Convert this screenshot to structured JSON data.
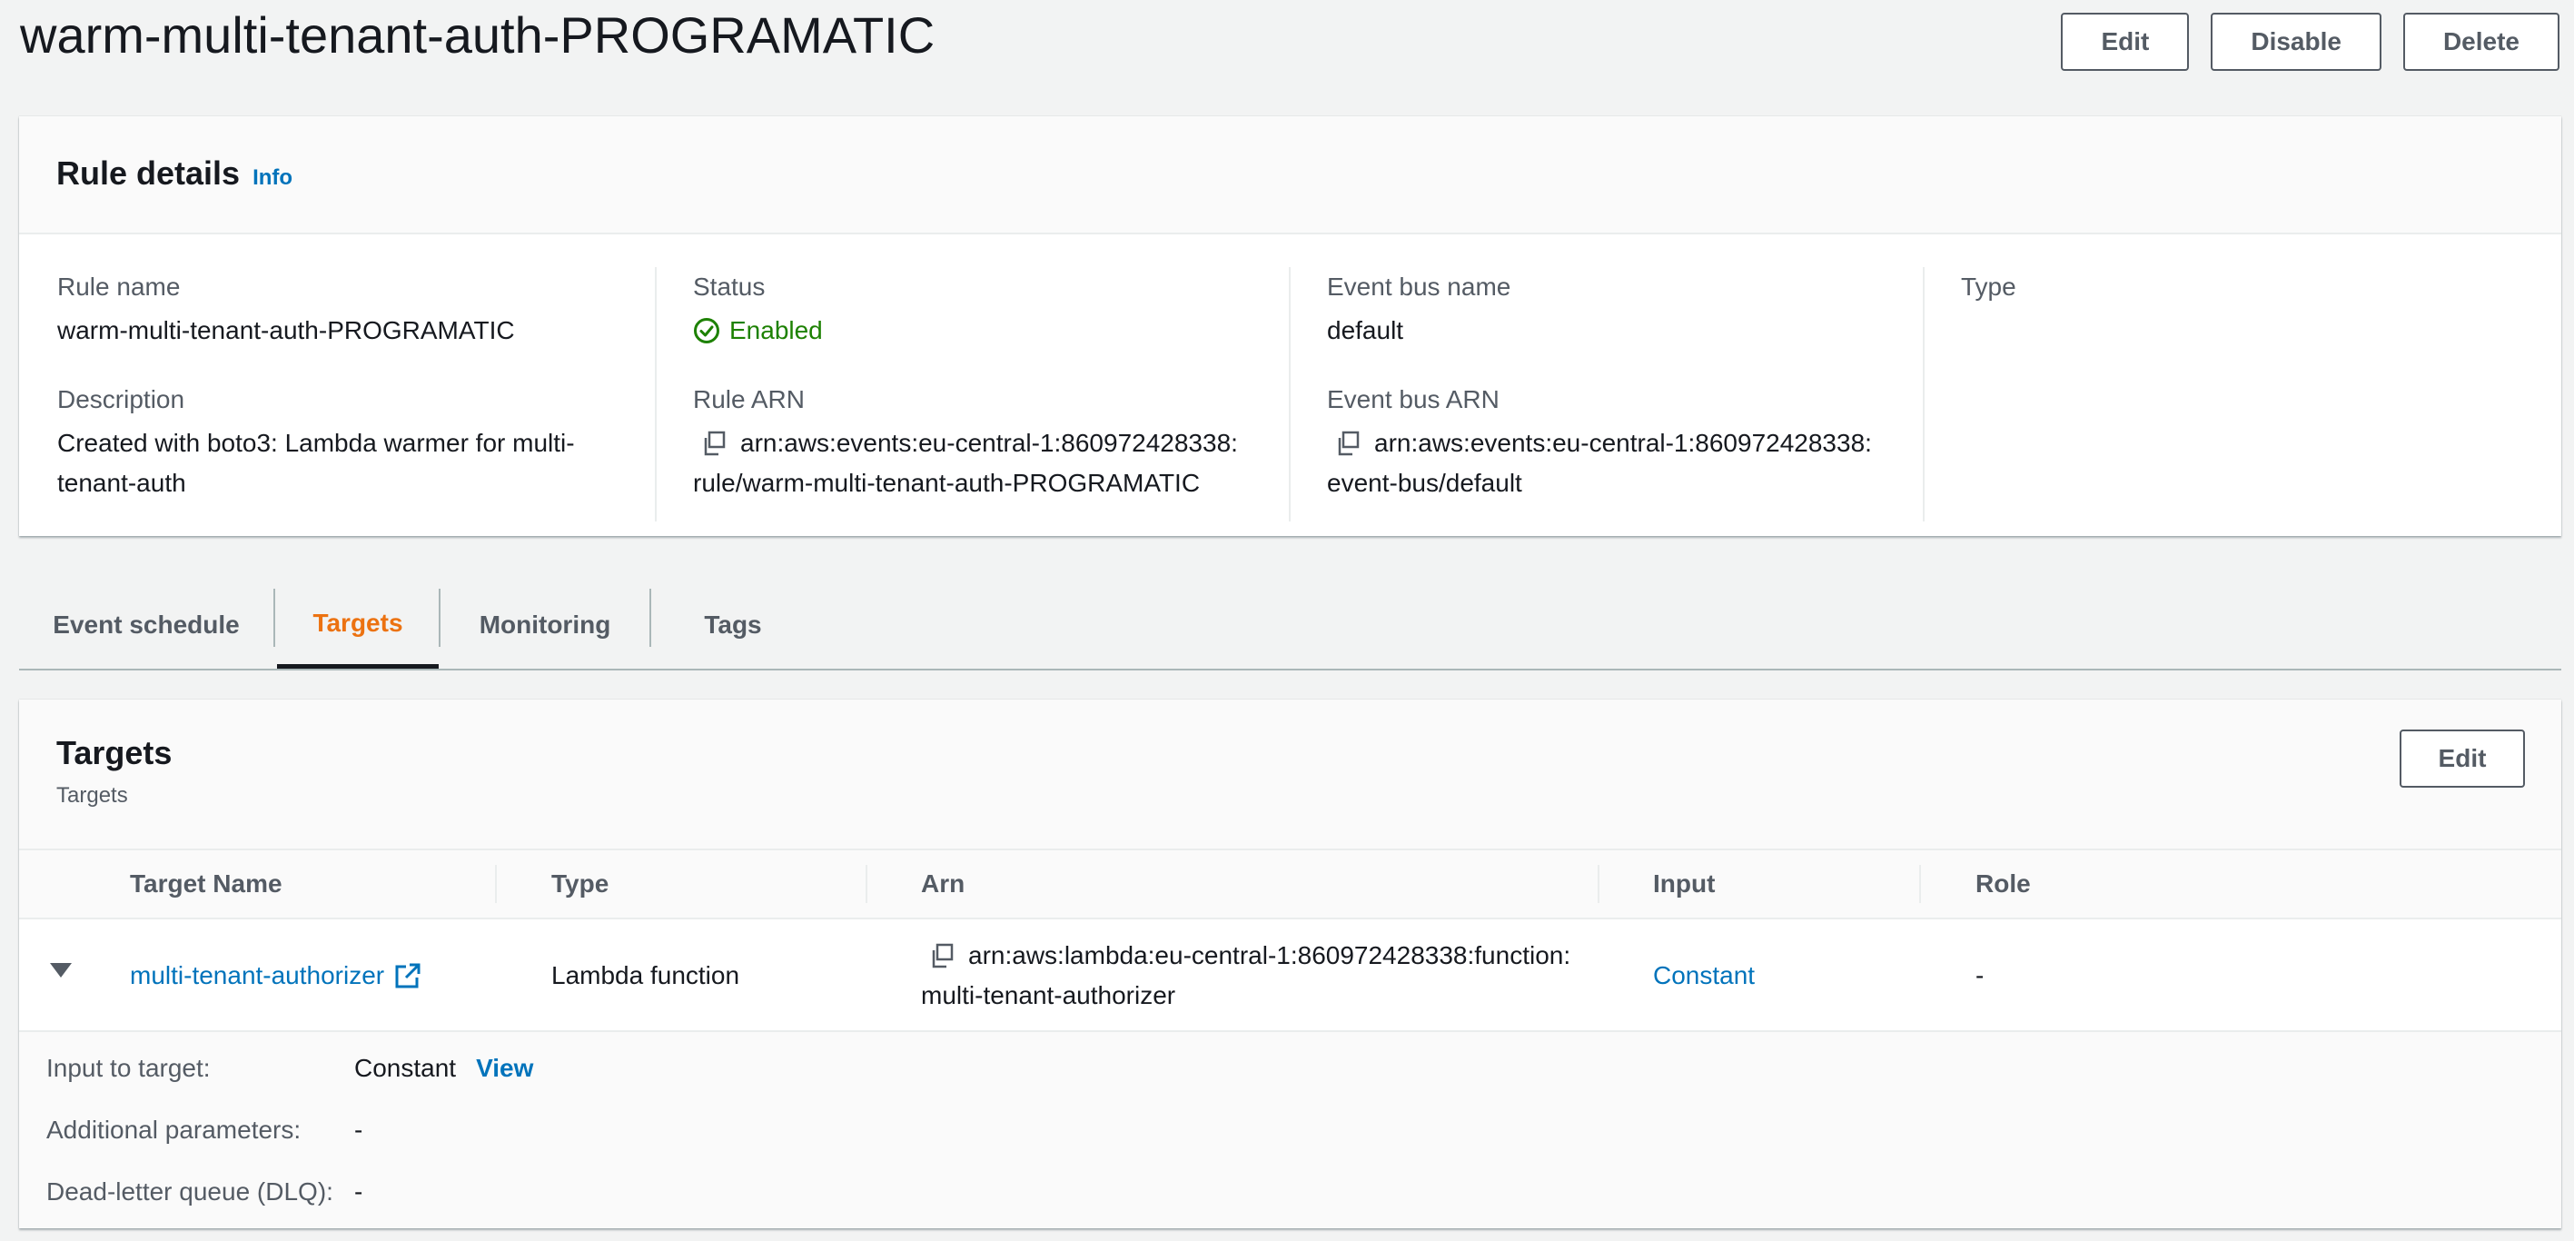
{
  "page": {
    "title": "warm-multi-tenant-auth-PROGRAMATIC"
  },
  "actions": {
    "edit": "Edit",
    "disable": "Disable",
    "delete": "Delete"
  },
  "rule_details": {
    "title": "Rule details",
    "info": "Info",
    "rule_name_label": "Rule name",
    "rule_name": "warm-multi-tenant-auth-PROGRAMATIC",
    "description_label": "Description",
    "description_line1": "Created with boto3: Lambda warmer for multi-",
    "description_line2": "tenant-auth",
    "status_label": "Status",
    "status": "Enabled",
    "rule_arn_label": "Rule ARN",
    "rule_arn_line1": "arn:aws:events:eu-central-1:860972428338:",
    "rule_arn_line2": "rule/warm-multi-tenant-auth-PROGRAMATIC",
    "event_bus_name_label": "Event bus name",
    "event_bus_name": "default",
    "event_bus_arn_label": "Event bus ARN",
    "event_bus_arn_line1": "arn:aws:events:eu-central-1:860972428338:",
    "event_bus_arn_line2": "event-bus/default",
    "type_label": "Type"
  },
  "tabs": [
    {
      "label": "Event schedule"
    },
    {
      "label": "Targets"
    },
    {
      "label": "Monitoring"
    },
    {
      "label": "Tags"
    }
  ],
  "active_tab": "Targets",
  "targets": {
    "title": "Targets",
    "subtitle": "Targets",
    "edit": "Edit",
    "columns": [
      "Target Name",
      "Type",
      "Arn",
      "Input",
      "Role"
    ],
    "row": {
      "name": "multi-tenant-authorizer",
      "type": "Lambda function",
      "arn_line1": "arn:aws:lambda:eu-central-1:860972428338:function:",
      "arn_line2": "multi-tenant-authorizer",
      "input": "Constant",
      "role": "-"
    },
    "detail": {
      "input_label": "Input to target:",
      "input_value": "Constant",
      "view": "View",
      "additional_label": "Additional parameters:",
      "additional_value": "-",
      "dlq_label": "Dead-letter queue (DLQ):",
      "dlq_value": "-"
    }
  },
  "colors": {
    "accent_tab": "#ec7211",
    "link": "#0073bb",
    "success": "#1d8102"
  },
  "icons": {
    "copy": "copy-icon",
    "external": "external-link-icon",
    "status": "check-circle-icon",
    "expand": "caret-down-icon"
  }
}
